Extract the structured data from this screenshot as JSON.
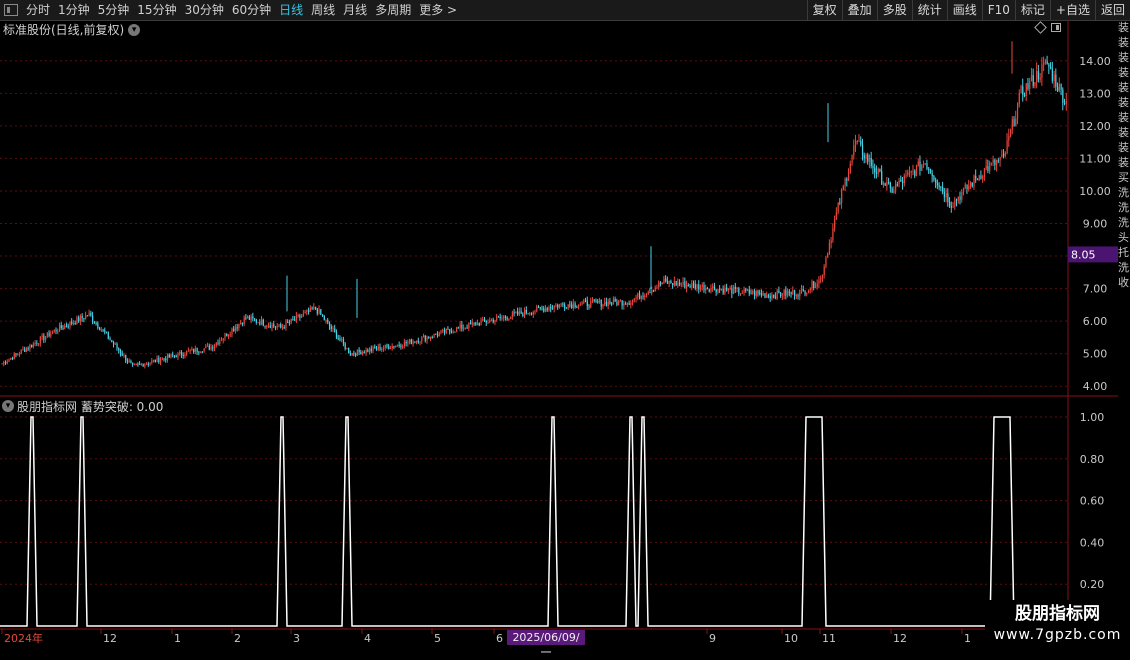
{
  "toolbar": {
    "periods": [
      "分时",
      "1分钟",
      "5分钟",
      "15分钟",
      "30分钟",
      "60分钟",
      "日线",
      "周线",
      "月线",
      "多周期",
      "更多 >"
    ],
    "active_period": "日线",
    "right_buttons": [
      "复权",
      "叠加",
      "多股",
      "统计",
      "画线",
      "F10",
      "标记",
      "+自选",
      "返回"
    ]
  },
  "main_chart": {
    "title": "标准股份(日线,前复权)",
    "price_ticks": [
      "14.00",
      "13.00",
      "12.00",
      "11.00",
      "10.00",
      "9.00",
      "8.00",
      "7.00",
      "6.00",
      "5.00",
      "4.00"
    ],
    "price_tick_values": [
      14,
      13,
      12,
      11,
      10,
      9,
      8,
      7,
      6,
      5,
      4
    ],
    "current_price_label": "8.05",
    "current_price_value": 8.05,
    "colors": {
      "up": "#e8463c",
      "down": "#4ad1e6",
      "grid": "#5a0f0f",
      "axis": "#8a1010",
      "price_tag": "#4a1470"
    }
  },
  "indicator": {
    "title": "股朋指标网 蓄势突破: 0.00",
    "ticks": [
      "1.00",
      "0.80",
      "0.60",
      "0.40",
      "0.20"
    ],
    "tick_values": [
      1.0,
      0.8,
      0.6,
      0.4,
      0.2
    ]
  },
  "date_axis": {
    "labels": [
      "2024年",
      "12",
      "1",
      "2",
      "3",
      "4",
      "5",
      "6",
      "9",
      "10",
      "11",
      "12",
      "1"
    ],
    "highlight": "2025/06/09/一"
  },
  "watermark": {
    "line1": "股朋指标网",
    "line2": "www.7gpzb.com"
  },
  "right_strip_text": "装装装装装装装装装装买洗洗洗头托洗收",
  "chart_data": {
    "type": "candlestick",
    "ylim": [
      3.7,
      14.7
    ],
    "segments": [
      {
        "from": 0,
        "to": 30,
        "start": 4.7,
        "end": 5.7
      },
      {
        "from": 30,
        "to": 50,
        "start": 5.7,
        "end": 6.2
      },
      {
        "from": 50,
        "to": 75,
        "start": 6.2,
        "end": 4.6
      },
      {
        "from": 75,
        "to": 110,
        "start": 4.6,
        "end": 5.1
      },
      {
        "from": 110,
        "to": 120,
        "start": 5.1,
        "end": 5.2
      },
      {
        "from": 120,
        "to": 140,
        "start": 5.2,
        "end": 6.1
      },
      {
        "from": 140,
        "to": 160,
        "start": 6.1,
        "end": 5.8
      },
      {
        "from": 160,
        "to": 180,
        "start": 5.8,
        "end": 6.4
      },
      {
        "from": 180,
        "to": 200,
        "start": 6.4,
        "end": 5.0
      },
      {
        "from": 200,
        "to": 230,
        "start": 5.0,
        "end": 5.3
      },
      {
        "from": 230,
        "to": 270,
        "start": 5.3,
        "end": 5.9
      },
      {
        "from": 270,
        "to": 320,
        "start": 5.9,
        "end": 6.5
      },
      {
        "from": 320,
        "to": 360,
        "start": 6.5,
        "end": 6.6
      },
      {
        "from": 360,
        "to": 380,
        "start": 6.6,
        "end": 7.2
      },
      {
        "from": 380,
        "to": 410,
        "start": 7.2,
        "end": 7.0
      },
      {
        "from": 410,
        "to": 440,
        "start": 7.0,
        "end": 6.8
      },
      {
        "from": 440,
        "to": 460,
        "start": 6.8,
        "end": 6.9
      },
      {
        "from": 460,
        "to": 470,
        "start": 6.9,
        "end": 7.3
      },
      {
        "from": 470,
        "to": 480,
        "start": 7.3,
        "end": 9.5
      },
      {
        "from": 480,
        "to": 490,
        "start": 9.5,
        "end": 11.5
      },
      {
        "from": 490,
        "to": 510,
        "start": 11.5,
        "end": 10.0
      },
      {
        "from": 510,
        "to": 530,
        "start": 10.0,
        "end": 10.9
      },
      {
        "from": 530,
        "to": 545,
        "start": 10.9,
        "end": 9.6
      },
      {
        "from": 545,
        "to": 565,
        "start": 9.6,
        "end": 10.7
      },
      {
        "from": 565,
        "to": 575,
        "start": 10.7,
        "end": 11.0
      },
      {
        "from": 575,
        "to": 585,
        "start": 11.0,
        "end": 13.0
      },
      {
        "from": 585,
        "to": 600,
        "start": 13.0,
        "end": 13.9
      },
      {
        "from": 600,
        "to": 612,
        "start": 13.9,
        "end": 12.6
      }
    ],
    "signals": [
      [
        31,
        33
      ],
      [
        81,
        83
      ],
      [
        281,
        283
      ],
      [
        346,
        348
      ],
      [
        552,
        554
      ],
      [
        630,
        632
      ],
      [
        642,
        644
      ],
      [
        806,
        822
      ],
      [
        994,
        1010
      ]
    ]
  }
}
